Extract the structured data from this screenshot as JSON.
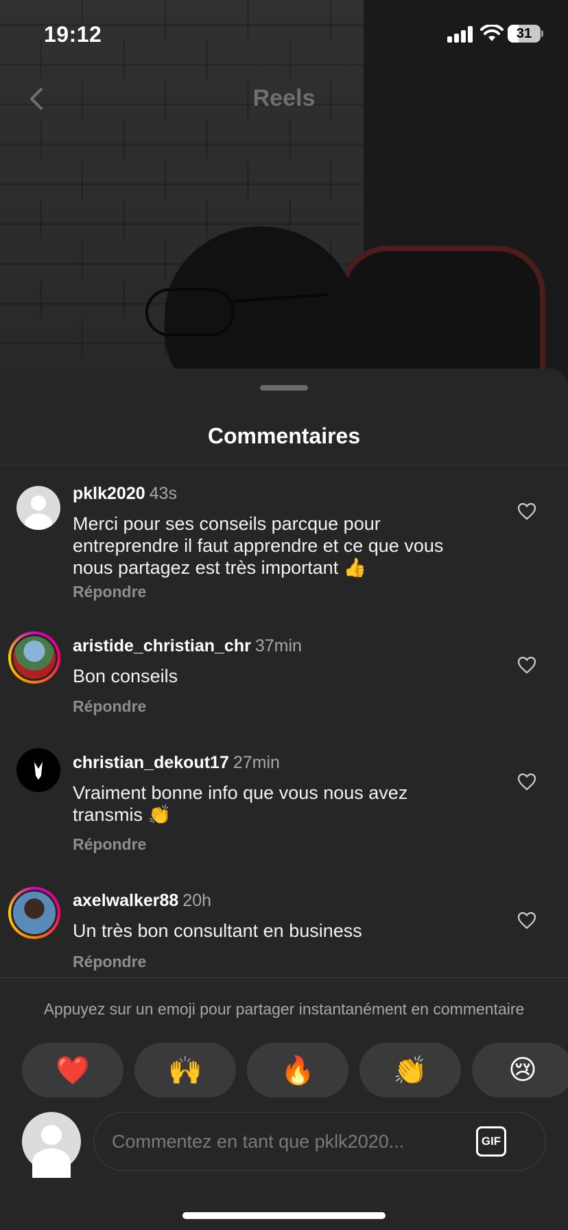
{
  "status_bar": {
    "time": "19:12",
    "battery": "31"
  },
  "header": {
    "title": "Reels",
    "back_icon": "chevron-left-icon"
  },
  "sheet": {
    "title": "Commentaires",
    "comments": [
      {
        "username": "pklk2020",
        "time": "43s",
        "lines": [
          "Merci pour ses conseils parcque pour",
          "entreprendre il faut apprendre et ce que vous",
          "nous partagez est très important 👍"
        ],
        "reply": "Répondre",
        "avatar": "default"
      },
      {
        "username": "aristide_christian_chr",
        "time": "37min",
        "lines": [
          "Bon conseils"
        ],
        "reply": "Répondre",
        "avatar": "story-ring"
      },
      {
        "username": "christian_dekout17",
        "time": "27min",
        "lines": [
          "Vraiment bonne info que vous nous avez",
          "transmis 👏"
        ],
        "reply": "Répondre",
        "avatar": "tuxedo"
      },
      {
        "username": "axelwalker88",
        "time": "20h",
        "lines": [
          "Un très bon consultant en business"
        ],
        "reply": "Répondre",
        "avatar": "story-ring"
      }
    ],
    "emoji_hint": "Appuyez sur un emoji pour partager instantanément en commentaire",
    "emojis": [
      "❤️",
      "🙌",
      "🔥",
      "👏",
      "😢"
    ],
    "composer": {
      "placeholder": "Commentez en tant que pklk2020...",
      "gif_label": "GIF"
    }
  },
  "colors": {
    "sheet_bg": "#262626",
    "secondary_text": "#a8a8a8",
    "story_ring": [
      "#d300c5",
      "#ff7a00",
      "#ffd600"
    ]
  }
}
